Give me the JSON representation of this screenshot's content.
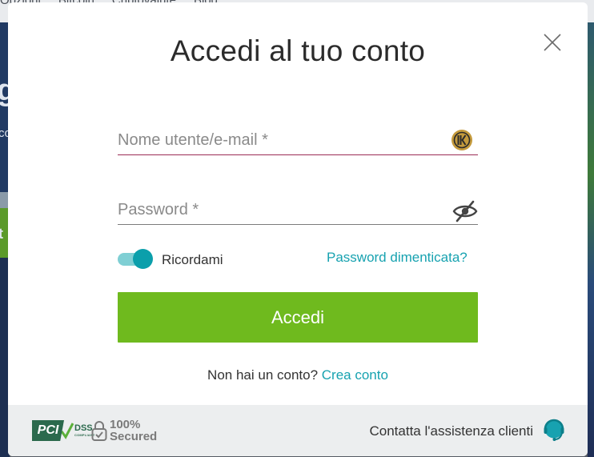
{
  "background": {
    "nav_items": [
      "Opzioni",
      "Bitcoin",
      "Criptovalute",
      "Blog"
    ],
    "left_fragments": [
      "g",
      "co",
      "t"
    ]
  },
  "modal": {
    "title": "Accedi al tuo conto",
    "username": {
      "placeholder": "Nome utente/e-mail *",
      "value": ""
    },
    "password": {
      "placeholder": "Password *",
      "value": ""
    },
    "remember": {
      "label": "Ricordami",
      "on": true
    },
    "forgot_label": "Password dimenticata?",
    "submit_label": "Accedi",
    "signup_prompt": "Non hai un conto?",
    "signup_link": "Crea conto"
  },
  "footer": {
    "pci_label": "PCI",
    "pci_dss": "DSS",
    "pci_compliant": "COMPLIANT",
    "secured_pct": "100%",
    "secured_word": "Secured",
    "support_label": "Contatta l'assistenza clienti"
  },
  "icons": {
    "close": "close-icon",
    "keeper": "keeper-icon",
    "eye": "eye-slash-icon",
    "lock": "lock-icon",
    "support": "chat-support-icon"
  },
  "colors": {
    "accent": "#17a2b0",
    "toggle_knob": "#0b9fab",
    "toggle_track": "#7fcfd4",
    "submit": "#6fba1e",
    "active_underline": "#9b2c55",
    "keeper": "#c49a3c"
  }
}
